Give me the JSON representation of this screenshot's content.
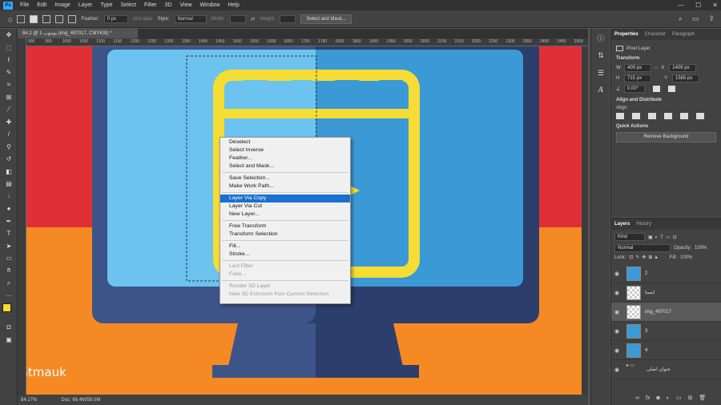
{
  "menu": {
    "logo": "Ps",
    "items": [
      "File",
      "Edit",
      "Image",
      "Layer",
      "Type",
      "Select",
      "Filter",
      "3D",
      "View",
      "Window",
      "Help"
    ],
    "window_controls": [
      "—",
      "☐",
      "✕"
    ]
  },
  "options_bar": {
    "feather_label": "Feather:",
    "feather_value": "0 px",
    "antialias_label": "Anti-alias",
    "style_label": "Style:",
    "style_value": "Normal",
    "width_label": "Width:",
    "height_label": "Height:",
    "select_mask_label": "Select and Mask..."
  },
  "document": {
    "tab_title": "84.2 @ 1 یوتیوب (img_497017, CMYK/8) *",
    "ruler_marks": [
      "900",
      "950",
      "1000",
      "1050",
      "1100",
      "1150",
      "1200",
      "1250",
      "1300",
      "1350",
      "1400",
      "1450",
      "1500",
      "1550",
      "1600",
      "1650",
      "1700",
      "1750",
      "1800",
      "1850",
      "1900",
      "1950",
      "2000",
      "2050",
      "2100",
      "2150",
      "2200",
      "2250",
      "2300",
      "2350",
      "2400",
      "2450",
      "2500"
    ],
    "zoom": "84.17%",
    "doc_size": "Doc: 66.4M/59.0M",
    "watermark": "atmauk"
  },
  "context_menu": {
    "groups": [
      [
        {
          "label": "Deselect",
          "state": "normal"
        },
        {
          "label": "Select Inverse",
          "state": "normal"
        },
        {
          "label": "Feather...",
          "state": "normal"
        },
        {
          "label": "Select and Mask...",
          "state": "normal"
        }
      ],
      [
        {
          "label": "Save Selection...",
          "state": "normal"
        },
        {
          "label": "Make Work Path...",
          "state": "normal"
        }
      ],
      [
        {
          "label": "Layer Via Copy",
          "state": "highlighted"
        },
        {
          "label": "Layer Via Cut",
          "state": "normal"
        },
        {
          "label": "New Layer...",
          "state": "normal"
        }
      ],
      [
        {
          "label": "Free Transform",
          "state": "normal"
        },
        {
          "label": "Transform Selection",
          "state": "normal"
        }
      ],
      [
        {
          "label": "Fill...",
          "state": "normal"
        },
        {
          "label": "Stroke...",
          "state": "normal"
        }
      ],
      [
        {
          "label": "Last Filter",
          "state": "disabled"
        },
        {
          "label": "Fade...",
          "state": "disabled"
        }
      ],
      [
        {
          "label": "Render 3D Layer",
          "state": "disabled"
        },
        {
          "label": "New 3D Extrusion from Current Selection",
          "state": "disabled"
        }
      ]
    ]
  },
  "properties_panel": {
    "tabs": [
      "Properties",
      "Character",
      "Paragraph"
    ],
    "kind": "Pixel Layer",
    "transform_title": "Transform",
    "w_label": "W",
    "w_value": "409 px",
    "x_label": "X",
    "x_value": "1409 px",
    "h_label": "H",
    "h_value": "715 px",
    "y_label": "Y",
    "y_value": "1585 px",
    "angle": "0.00°",
    "align_title": "Align and Distribute",
    "align_label": "Align:",
    "quick_title": "Quick Actions",
    "remove_bg": "Remove Background"
  },
  "layers_panel": {
    "tabs": [
      "Layers",
      "History"
    ],
    "kind_filter": "Kind",
    "blend_mode": "Normal",
    "opacity_label": "Opacity:",
    "opacity_value": "100%",
    "lock_label": "Lock:",
    "fill_label": "Fill:",
    "fill_value": "100%",
    "layers": [
      {
        "name": "2",
        "thumb": "icon",
        "selected": false
      },
      {
        "name": "ایستا",
        "thumb": "checker",
        "selected": false
      },
      {
        "name": "img_497017",
        "thumb": "checker",
        "selected": true
      },
      {
        "name": "3",
        "thumb": "icon",
        "selected": false
      },
      {
        "name": "4",
        "thumb": "icon",
        "selected": false
      },
      {
        "name": "عنوان اصلی",
        "thumb": "folder",
        "selected": false
      }
    ]
  },
  "colors": {
    "bg_red": "#e12f36",
    "bg_orange": "#f58a24",
    "screen_light": "#6cc3ef",
    "screen_dark": "#3b9ad6",
    "bezel": "#2c3e6b",
    "stand": "#3d5489",
    "clapper": "#f5dd34",
    "highlight": "#1a6fd1"
  }
}
